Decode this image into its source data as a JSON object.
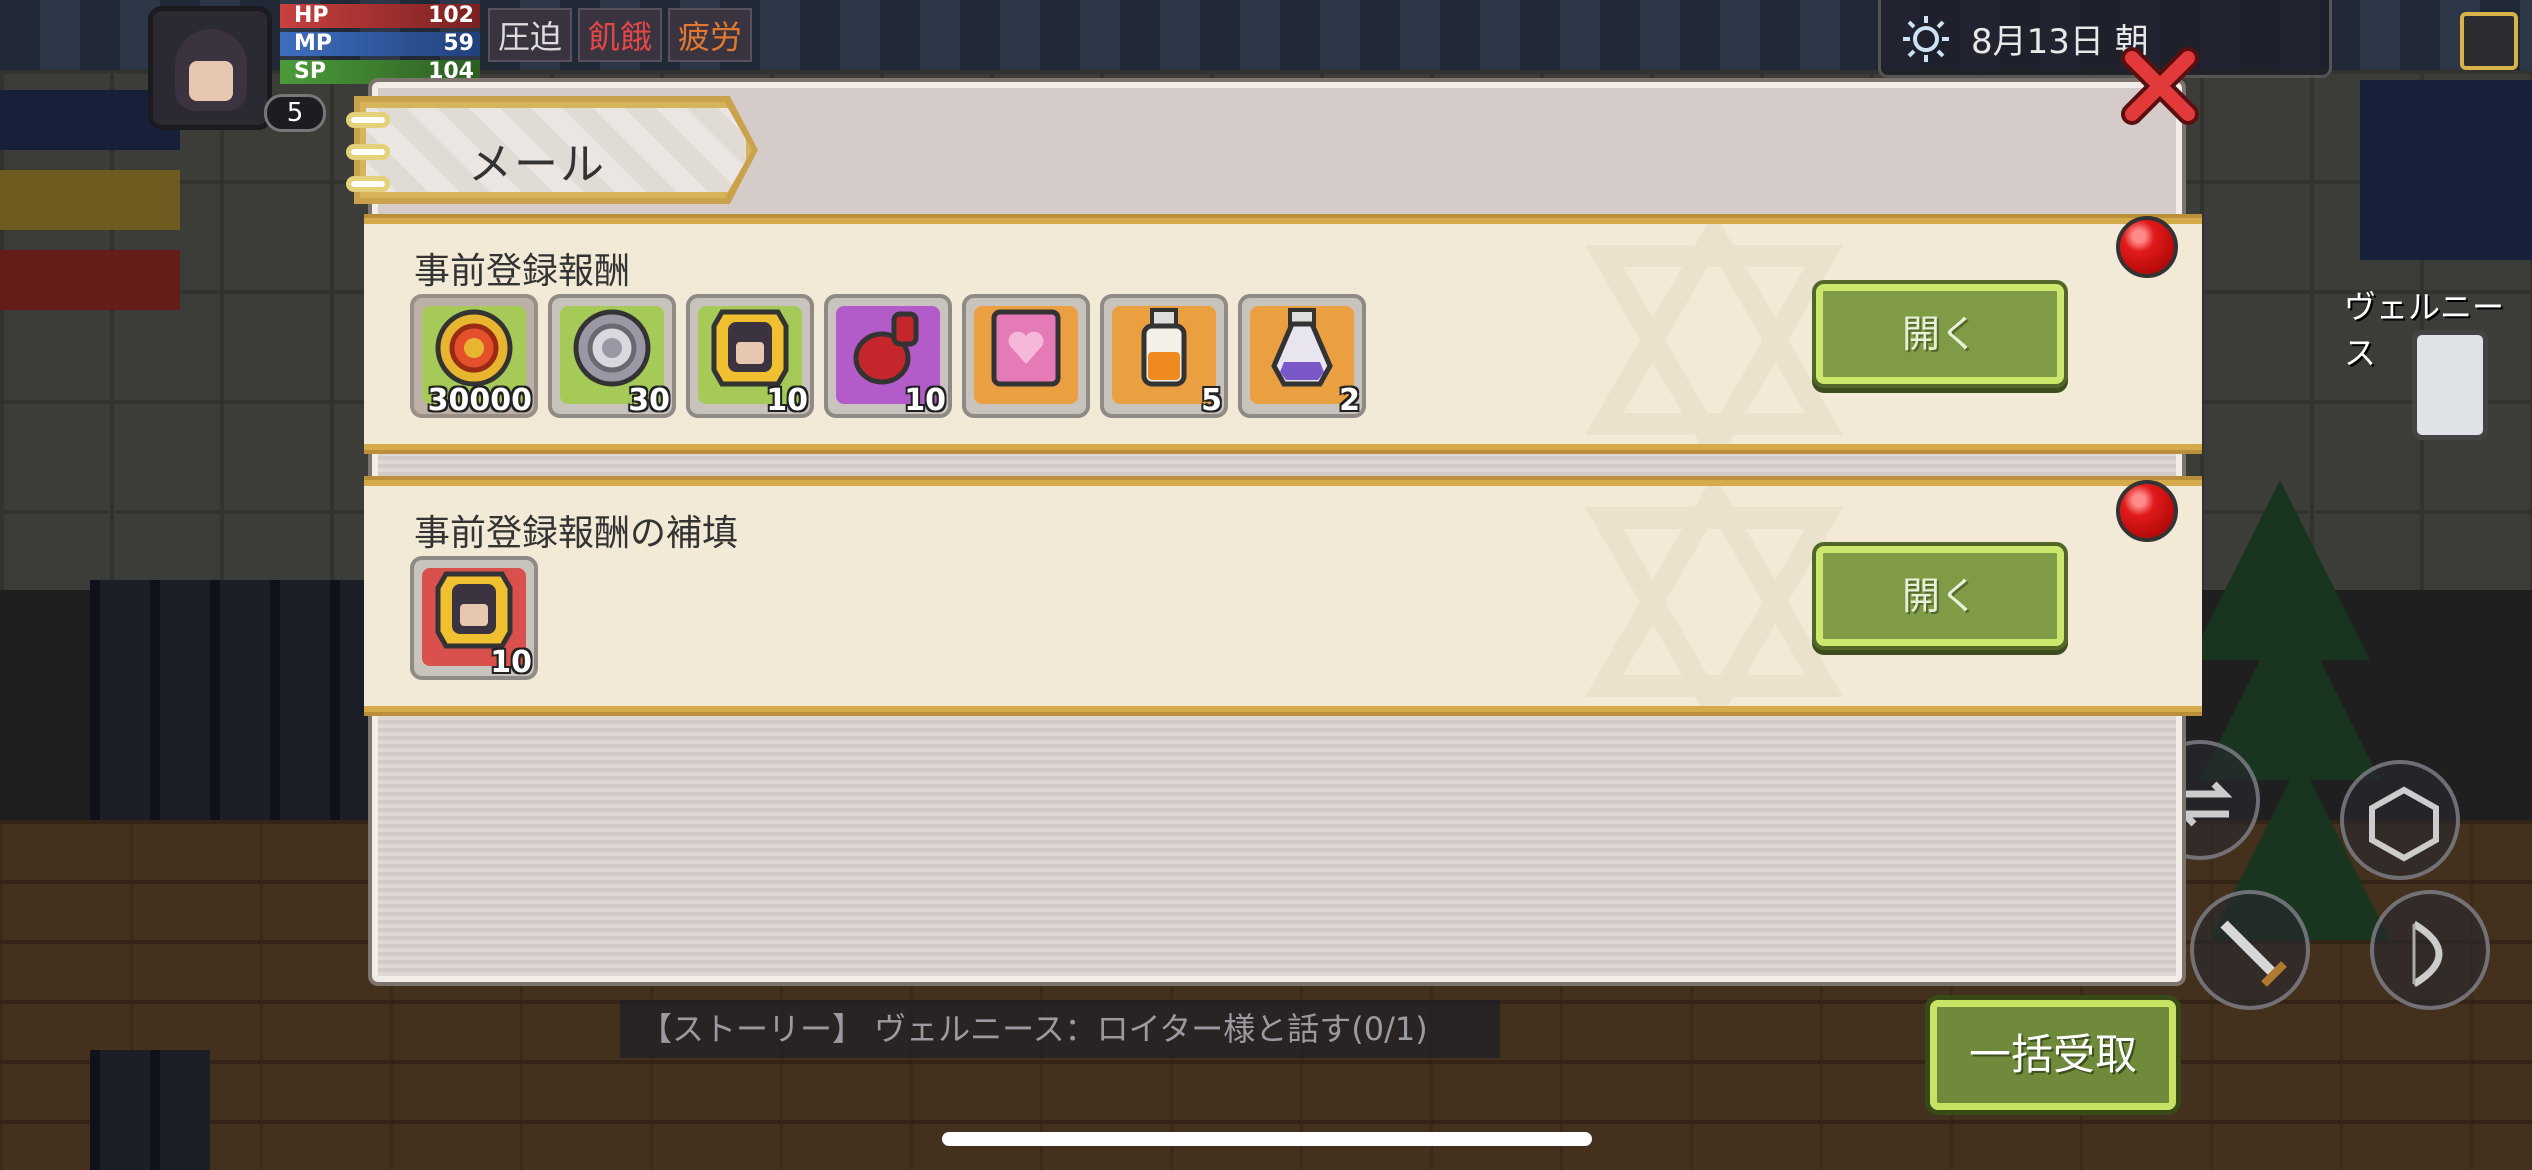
{
  "hud": {
    "level": "5",
    "hp_label": "HP",
    "hp_value": "102",
    "mp_label": "MP",
    "mp_value": "59",
    "sp_label": "SP",
    "sp_value": "104",
    "status_tags": [
      "圧迫",
      "飢餓",
      "疲労"
    ],
    "date": "8月13日 朝",
    "npc_name": "ヴェルニース"
  },
  "quest": {
    "text": "【ストーリー】 ヴェルニース：ロイター様と話す(0/1)"
  },
  "mail": {
    "title": "メール",
    "open_label": "開く",
    "bulk_claim_label": "一括受取",
    "items": [
      {
        "title": "事前登録報酬",
        "rewards": [
          {
            "icon": "gold-coin-icon",
            "count": "30000"
          },
          {
            "icon": "silver-coin-icon",
            "count": "30"
          },
          {
            "icon": "character-token-icon",
            "count": "10"
          },
          {
            "icon": "red-bag-icon",
            "count": "10"
          },
          {
            "icon": "heart-book-icon",
            "count": ""
          },
          {
            "icon": "orange-potion-icon",
            "count": "5"
          },
          {
            "icon": "purple-potion-icon",
            "count": "2"
          }
        ]
      },
      {
        "title": "事前登録報酬の補填",
        "rewards": [
          {
            "icon": "character-token-icon",
            "count": "10"
          }
        ]
      }
    ]
  },
  "colors": {
    "panel_bg": "#d2cac6",
    "item_bg": "#f2ead6",
    "item_border": "#d4aa4a",
    "button_green": "#7f9b46",
    "button_border": "#cce86c",
    "notification_red": "#e21b1b"
  }
}
